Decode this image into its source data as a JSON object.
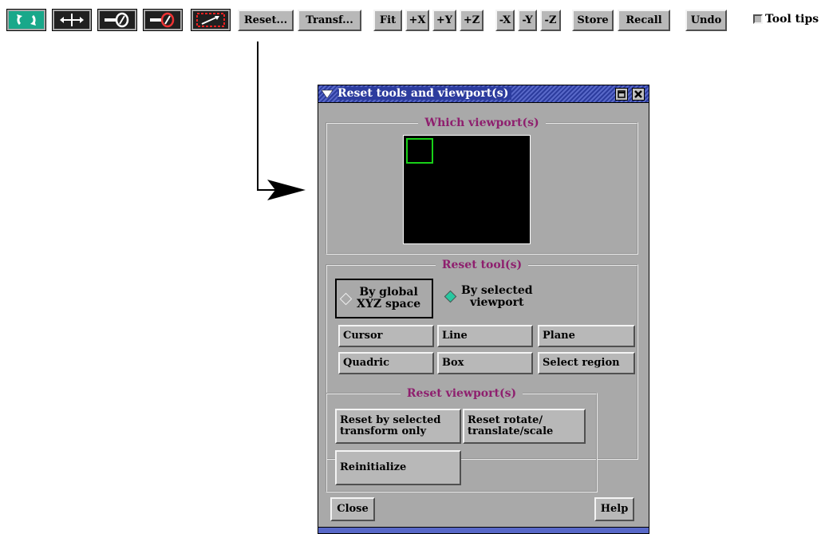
{
  "toolbar": {
    "icons": [
      {
        "name": "rotate-tool-icon",
        "active": true
      },
      {
        "name": "translate-tool-icon",
        "active": false
      },
      {
        "name": "lens-white-tool-icon",
        "active": false
      },
      {
        "name": "lens-red-tool-icon",
        "active": false
      },
      {
        "name": "zoom-region-tool-icon",
        "active": false
      }
    ],
    "reset_label": "Reset...",
    "transform_label": "Transf...",
    "fit_label": "Fit",
    "plus_x": "+X",
    "plus_y": "+Y",
    "plus_z": "+Z",
    "minus_x": "-X",
    "minus_y": "-Y",
    "minus_z": "-Z",
    "store_label": "Store",
    "recall_label": "Recall",
    "undo_label": "Undo",
    "tooltips_label": "Tool tips",
    "tooltips_checked": false,
    "active_color": "#19a88a"
  },
  "dialog": {
    "title": "Reset tools and viewport(s)",
    "which_viewport_label": "Which viewport(s)",
    "viewport_selection_color": "#18d018",
    "reset_tools_label": "Reset tool(s)",
    "radio_global": "By global\nXYZ space",
    "radio_selected": "By selected\nviewport",
    "radio_selected_active": true,
    "radio_active_color": "#28c8a0",
    "tool_buttons": [
      "Cursor",
      "Line",
      "Plane",
      "Quadric",
      "Box",
      "Select region"
    ],
    "reset_viewport_label": "Reset viewport(s)",
    "reset_selected_transform": "Reset by selected\ntransform only",
    "reset_rotate": "Reset rotate/\ntranslate/scale",
    "reinitialize": "Reinitialize",
    "close_label": "Close",
    "help_label": "Help",
    "label_color": "#8e1f6e",
    "title_bar_color": "#2c3c9e"
  }
}
